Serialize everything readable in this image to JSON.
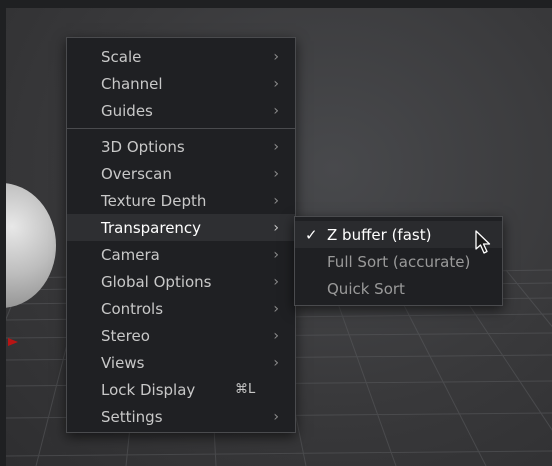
{
  "menu": {
    "items": [
      {
        "label": "Scale",
        "chevron": "›"
      },
      {
        "label": "Channel",
        "chevron": "›"
      },
      {
        "label": "Guides",
        "chevron": "›"
      },
      {
        "label": "3D Options",
        "chevron": "›"
      },
      {
        "label": "Overscan",
        "chevron": "›"
      },
      {
        "label": "Texture Depth",
        "chevron": "›"
      },
      {
        "label": "Transparency",
        "chevron": "›"
      },
      {
        "label": "Camera",
        "chevron": "›"
      },
      {
        "label": "Global Options",
        "chevron": "›"
      },
      {
        "label": "Controls",
        "chevron": "›"
      },
      {
        "label": "Stereo",
        "chevron": "›"
      },
      {
        "label": "Views",
        "chevron": "›"
      },
      {
        "label": "Lock Display",
        "shortcut": "⌘L"
      },
      {
        "label": "Settings",
        "chevron": "›"
      }
    ]
  },
  "submenu": {
    "items": [
      {
        "label": "Z buffer (fast)",
        "check": "✓"
      },
      {
        "label": "Full Sort (accurate)"
      },
      {
        "label": "Quick Sort"
      }
    ]
  },
  "colors": {
    "menu_bg": "#1f2023",
    "menu_border": "#4a4b4e",
    "text": "#c8c8c8",
    "highlight_text": "#ffffff",
    "red_marker": "#b81414"
  },
  "icons": {
    "chevron": "chevron-right-icon",
    "check": "checkmark-icon",
    "cursor": "mouse-pointer-icon"
  }
}
